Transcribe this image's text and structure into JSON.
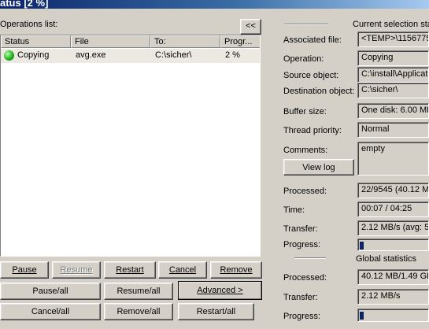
{
  "window": {
    "title": "atus [2 %]"
  },
  "operations_list": {
    "label": "Operations list:",
    "collapse_button": "<<",
    "columns": [
      "Status",
      "File",
      "To:",
      "Progr..."
    ],
    "rows": [
      {
        "status": "Copying",
        "file": "avg.exe",
        "to": "C:\\sicher\\",
        "progress": "2 %"
      }
    ]
  },
  "buttons": {
    "pause": "Pause",
    "resume": "Resume",
    "restart": "Restart",
    "cancel": "Cancel",
    "remove": "Remove",
    "pause_all": "Pause/all",
    "resume_all": "Resume/all",
    "advanced": "Advanced >",
    "cancel_all": "Cancel/all",
    "remove_all": "Remove/all",
    "restart_all": "Restart/all",
    "view_log": "View log"
  },
  "current_selection": {
    "title": "Current selection sta",
    "associated_file_label": "Associated file:",
    "associated_file": "<TEMP>\\1156775",
    "operation_label": "Operation:",
    "operation": "Copying",
    "source_label": "Source object:",
    "source": "C:\\install\\Applicati",
    "destination_label": "Destination object:",
    "destination": "C:\\sicher\\",
    "buffer_label": "Buffer size:",
    "buffer": "One disk: 6.00 MB",
    "thread_label": "Thread priority:",
    "thread": "Normal",
    "comments_label": "Comments:",
    "comments": "empty",
    "processed_label": "Processed:",
    "processed": "22/9545 (40.12 M",
    "time_label": "Time:",
    "time": "00:07 / 04:25",
    "transfer_label": "Transfer:",
    "transfer": "2.12 MB/s (avg: 5",
    "progress_label": "Progress:",
    "progress_fraction": 0.02
  },
  "global_statistics": {
    "title": "Global statistics",
    "processed_label": "Processed:",
    "processed": "40.12 MB/1.49 GB",
    "transfer_label": "Transfer:",
    "transfer": "2.12 MB/s",
    "progress_label": "Progress:",
    "progress_fraction": 0.03
  },
  "colors": {
    "status_ok": "#22b022",
    "titlebar": "#0a246a",
    "face": "#d4d0c8"
  }
}
